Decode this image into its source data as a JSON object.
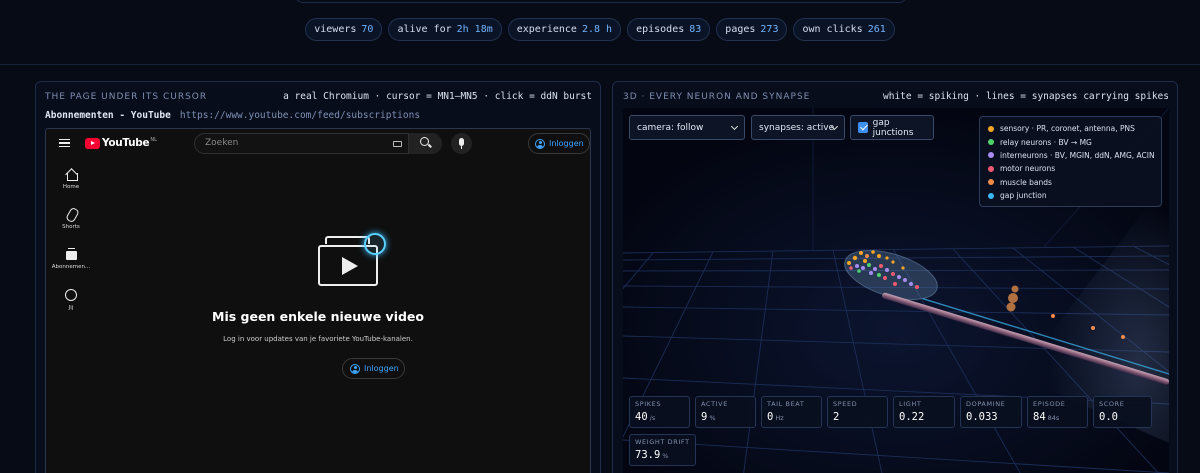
{
  "stats": [
    {
      "label": "viewers",
      "value": "70"
    },
    {
      "label": "alive for",
      "value": "2h 18m"
    },
    {
      "label": "experience",
      "value": "2.8 h"
    },
    {
      "label": "episodes",
      "value": "83"
    },
    {
      "label": "pages",
      "value": "273"
    },
    {
      "label": "own clicks",
      "value": "261"
    }
  ],
  "left_panel": {
    "title": "THE PAGE UNDER ITS CURSOR",
    "subtitle": "a real Chromium · cursor = MN1–MN5 · click = ddN burst",
    "page_title": "Abonnementen - YouTube",
    "page_url": "https://www.youtube.com/feed/subscriptions"
  },
  "youtube": {
    "logo_text": "YouTube",
    "country_code": "NL",
    "search_placeholder": "Zoeken",
    "login_label": "Inloggen",
    "sidebar": [
      {
        "label": "Home",
        "icon": "home-icon"
      },
      {
        "label": "Shorts",
        "icon": "shorts-icon"
      },
      {
        "label": "Abonnemen...",
        "icon": "subscriptions-icon"
      },
      {
        "label": "Jij",
        "icon": "you-icon"
      }
    ],
    "empty_title": "Mis geen enkele nieuwe video",
    "empty_subtitle": "Log in voor updates van je favoriete YouTube-kanalen.",
    "empty_login_label": "Inloggen",
    "accent_color": "#3ea6ff",
    "brand_color": "#ff0033"
  },
  "right_panel": {
    "title": "3D · EVERY NEURON AND SYNAPSE",
    "subtitle": "white = spiking · lines = synapses carrying spikes",
    "camera_select": "camera: follow",
    "synapse_select": "synapses: active",
    "gap_junctions_label": "gap junctions",
    "gap_junctions_checked": true,
    "legend": [
      {
        "label": "sensory · PR, coronet, antenna, PNS",
        "color": "#f5a524"
      },
      {
        "label": "relay neurons · BV → MG",
        "color": "#4fd36b"
      },
      {
        "label": "interneurons · BV, MGIN, ddN, AMG, ACIN",
        "color": "#a88cf0"
      },
      {
        "label": "motor neurons",
        "color": "#f05a6e"
      },
      {
        "label": "muscle bands",
        "color": "#f08a48"
      },
      {
        "label": "gap junction",
        "color": "#3ab8f5"
      }
    ],
    "metrics": [
      {
        "label": "SPIKES",
        "value": "40",
        "unit": "/s"
      },
      {
        "label": "ACTIVE",
        "value": "9",
        "unit": "%"
      },
      {
        "label": "TAIL BEAT",
        "value": "0",
        "unit": "Hz"
      },
      {
        "label": "SPEED",
        "value": "2",
        "unit": ""
      },
      {
        "label": "LIGHT",
        "value": "0.22",
        "unit": ""
      },
      {
        "label": "DOPAMINE",
        "value": "0.033",
        "unit": ""
      },
      {
        "label": "EPISODE",
        "value": "84",
        "unit": "84s"
      },
      {
        "label": "SCORE",
        "value": "0.0",
        "unit": ""
      },
      {
        "label": "WEIGHT DRIFT",
        "value": "73.9",
        "unit": "%"
      }
    ]
  }
}
